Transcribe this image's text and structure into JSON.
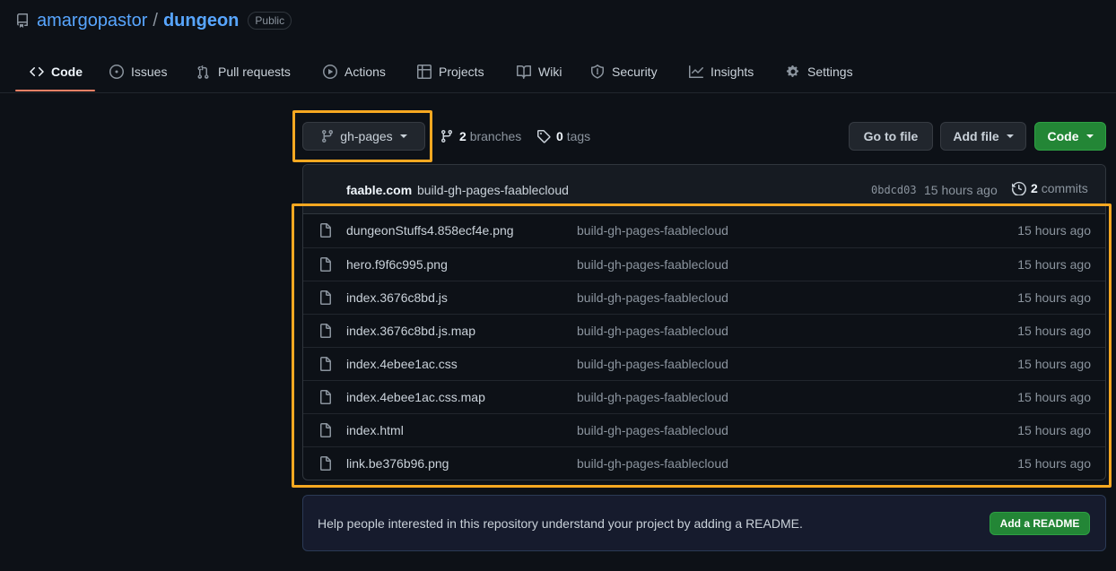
{
  "repo": {
    "owner": "amargopastor",
    "separator": "/",
    "name": "dungeon",
    "visibility": "Public"
  },
  "tabs": [
    {
      "label": "Code",
      "icon": "code-icon",
      "active": true
    },
    {
      "label": "Issues",
      "icon": "issue-icon"
    },
    {
      "label": "Pull requests",
      "icon": "pull-request-icon"
    },
    {
      "label": "Actions",
      "icon": "play-icon"
    },
    {
      "label": "Projects",
      "icon": "table-icon"
    },
    {
      "label": "Wiki",
      "icon": "book-icon"
    },
    {
      "label": "Security",
      "icon": "shield-icon"
    },
    {
      "label": "Insights",
      "icon": "graph-icon"
    },
    {
      "label": "Settings",
      "icon": "gear-icon"
    }
  ],
  "toolbar": {
    "branch": "gh-pages",
    "branches_count": "2",
    "branches_label": "branches",
    "tags_count": "0",
    "tags_label": "tags",
    "go_to_file": "Go to file",
    "add_file": "Add file",
    "code": "Code"
  },
  "commit": {
    "author": "faable.com",
    "message": "build-gh-pages-faablecloud",
    "sha": "0bdcd03",
    "time": "15 hours ago",
    "count": "2",
    "count_label": "commits"
  },
  "files": [
    {
      "name": "dungeonStuffs4.858ecf4e.png",
      "message": "build-gh-pages-faablecloud",
      "time": "15 hours ago"
    },
    {
      "name": "hero.f9f6c995.png",
      "message": "build-gh-pages-faablecloud",
      "time": "15 hours ago"
    },
    {
      "name": "index.3676c8bd.js",
      "message": "build-gh-pages-faablecloud",
      "time": "15 hours ago"
    },
    {
      "name": "index.3676c8bd.js.map",
      "message": "build-gh-pages-faablecloud",
      "time": "15 hours ago"
    },
    {
      "name": "index.4ebee1ac.css",
      "message": "build-gh-pages-faablecloud",
      "time": "15 hours ago"
    },
    {
      "name": "index.4ebee1ac.css.map",
      "message": "build-gh-pages-faablecloud",
      "time": "15 hours ago"
    },
    {
      "name": "index.html",
      "message": "build-gh-pages-faablecloud",
      "time": "15 hours ago"
    },
    {
      "name": "link.be376b96.png",
      "message": "build-gh-pages-faablecloud",
      "time": "15 hours ago"
    }
  ],
  "readme": {
    "text": "Help people interested in this repository understand your project by adding a README.",
    "button": "Add a README"
  },
  "colors": {
    "background": "#0d1117",
    "link": "#58a6ff",
    "primary_button": "#238636",
    "active_tab_underline": "#f78166",
    "highlight": "#f6a821"
  }
}
